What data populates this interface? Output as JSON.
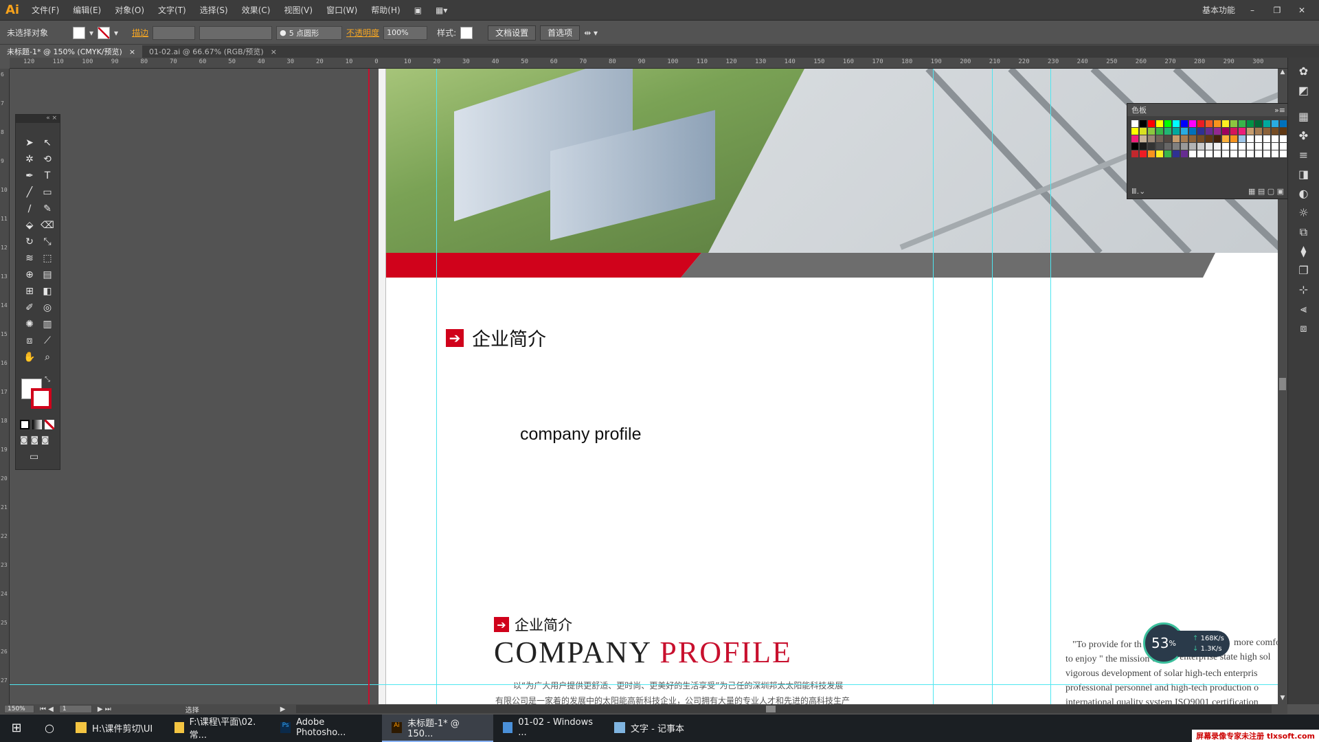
{
  "app": {
    "logo": "Ai",
    "workspace": "基本功能"
  },
  "menu": [
    "文件(F)",
    "编辑(E)",
    "对象(O)",
    "文字(T)",
    "选择(S)",
    "效果(C)",
    "视图(V)",
    "窗口(W)",
    "帮助(H)"
  ],
  "control": {
    "selection": "未选择对象",
    "stroke_label": "描边",
    "brush_size": "5 点圆形",
    "opacity_label": "不透明度",
    "opacity_value": "100%",
    "style_label": "样式:",
    "doc_setup": "文档设置",
    "preferences": "首选项"
  },
  "tabs": [
    {
      "label": "未标题-1* @ 150% (CMYK/预览)",
      "active": true
    },
    {
      "label": "01-02.ai @ 66.67% (RGB/预览)",
      "active": false
    }
  ],
  "ruler": {
    "h": [
      "120",
      "110",
      "100",
      "90",
      "80",
      "70",
      "60",
      "50",
      "40",
      "30",
      "20",
      "10",
      "0",
      "10",
      "20",
      "30",
      "40",
      "50",
      "60",
      "70",
      "80",
      "90",
      "100",
      "110",
      "120",
      "130",
      "140",
      "150",
      "160",
      "170",
      "180",
      "190",
      "200",
      "210",
      "220",
      "230",
      "240",
      "250",
      "260",
      "270",
      "280",
      "290",
      "300"
    ],
    "v": [
      "6",
      "7",
      "8",
      "9",
      "10",
      "11",
      "12",
      "13",
      "14",
      "15",
      "16",
      "17",
      "18",
      "19",
      "20",
      "21",
      "22",
      "23",
      "24",
      "25",
      "26",
      "27"
    ]
  },
  "artboard": {
    "heading_cn": "企业简介",
    "subheading_en": "company profile",
    "preview_heading_cn": "企业简介",
    "preview_title_black": "COMPANY",
    "preview_title_red": "PROFILE",
    "preview_line1": "以“为广大用户提供更舒适、更时尚、更美好的生活享受”为己任的深圳邦太太阳能科技发展",
    "preview_line2": "有限公司是一家着的发展中的太阳能高新科技企业，公司拥有大量的专业人才和先进的高科技生产",
    "en_lines": [
      "\"To provide for th",
      "to enjoy \" the mission of",
      "vigorous development of solar high-tech enterpris",
      "professional personnel and high-tech production o",
      "international quality system ISO9001 certification"
    ],
    "en_right": [
      "more comfo",
      "enterprise state high sol"
    ]
  },
  "swatches_panel": {
    "title": "色板",
    "colors": [
      "#ffffff",
      "#000000",
      "#ff0000",
      "#ffff00",
      "#00ff00",
      "#00ffff",
      "#0000ff",
      "#ff00ff",
      "#ec1c24",
      "#f15a24",
      "#f7931e",
      "#fcee21",
      "#8cc63f",
      "#39b54a",
      "#009245",
      "#006837",
      "#00a99d",
      "#29abe2",
      "#0071bc",
      "#2e3192",
      "#ffff00",
      "#d9e021",
      "#8cc63f",
      "#39b54a",
      "#22b573",
      "#00a99d",
      "#29abe2",
      "#0071bc",
      "#2e3192",
      "#662d91",
      "#93278f",
      "#9e005d",
      "#d4145a",
      "#ed1e79",
      "#c69c6d",
      "#a67c52",
      "#8c6239",
      "#754c24",
      "#603813",
      "#42210b",
      "#ed1e79",
      "#c7b299",
      "#998675",
      "#736357",
      "#534741",
      "#c69c6d",
      "#a67c52",
      "#8c6239",
      "#754c24",
      "#603813",
      "#42210b",
      "#fbb03b",
      "#f7931e",
      "#9ec5e8",
      "#ffffff",
      "#ffffff",
      "#ffffff",
      "#ffffff",
      "#ffffff",
      "#ffffff",
      "#000000",
      "#1a1a1a",
      "#333333",
      "#4d4d4d",
      "#666666",
      "#808080",
      "#999999",
      "#b3b3b3",
      "#cccccc",
      "#e6e6e6",
      "#f2f2f2",
      "#ffffff",
      "#ffffff",
      "#ffffff",
      "#ffffff",
      "#ffffff",
      "#ffffff",
      "#ffffff",
      "#ffffff",
      "#ffffff",
      "#c1272d",
      "#ed1c24",
      "#f7931e",
      "#fcee21",
      "#39b54a",
      "#2e3192",
      "#662d91",
      "#ffffff",
      "#ffffff",
      "#ffffff",
      "#ffffff",
      "#ffffff",
      "#ffffff",
      "#ffffff",
      "#ffffff",
      "#ffffff",
      "#ffffff",
      "#ffffff",
      "#ffffff",
      "#ffffff"
    ]
  },
  "status": {
    "zoom": "150%",
    "page": "1",
    "mode": "选择"
  },
  "speed": {
    "percent": "53",
    "pct_symbol": "%",
    "up": "168K/s",
    "down": "1.3K/s"
  },
  "taskbar": [
    {
      "label": "H:\\课件剪切\\UI",
      "icon": "folder-icon",
      "active": false
    },
    {
      "label": "F:\\课程\\平面\\02.常...",
      "icon": "folder-icon",
      "active": false
    },
    {
      "label": "Adobe Photosho...",
      "icon": "photoshop-icon",
      "active": false
    },
    {
      "label": "未标题-1* @ 150...",
      "icon": "illustrator-icon",
      "active": true
    },
    {
      "label": "01-02 - Windows ...",
      "icon": "image-viewer-icon",
      "active": false
    },
    {
      "label": "文字 - 记事本",
      "icon": "notepad-icon",
      "active": false
    }
  ],
  "watermark": "屏幕录像专家未注册 tlxsoft.com",
  "colors": {
    "accent_red": "#d0021b",
    "guide": "#4ee6f0",
    "bar_gray": "#6d6d6d"
  }
}
